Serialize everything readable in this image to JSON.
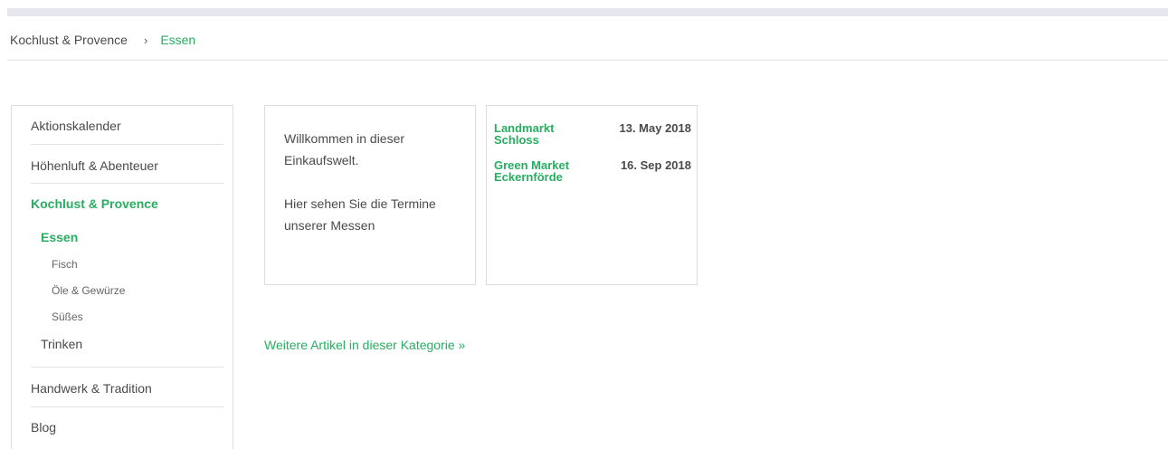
{
  "breadcrumb": {
    "items": [
      "Kochlust & Provence",
      "Essen"
    ],
    "separator": "›"
  },
  "sidebar": {
    "items": [
      {
        "label": "Aktionskalender"
      },
      {
        "label": "Höhenluft & Abenteuer"
      },
      {
        "label": "Kochlust & Provence",
        "active": true
      },
      {
        "label": "Handwerk & Tradition"
      },
      {
        "label": "Blog"
      }
    ],
    "sub": {
      "essen": "Essen",
      "fisch": "Fisch",
      "oele": "Öle & Gewürze",
      "suesses": "Süßes",
      "trinken": "Trinken"
    }
  },
  "welcome": {
    "line1": "Willkommen in dieser",
    "line2": "Einkaufswelt.",
    "line3": "Hier sehen Sie die Termine",
    "line4": "unserer Messen"
  },
  "events": [
    {
      "name_line1": "Landmarkt",
      "name_line2": "Schloss",
      "date": "13. May 2018"
    },
    {
      "name_line1": "Green Market",
      "name_line2": "Eckernförde",
      "date": "16. Sep 2018"
    }
  ],
  "more_link": "Weitere Artikel in dieser Kategorie »",
  "colors": {
    "accent": "#27ae60",
    "text": "#4a4a4a",
    "border": "#dcdcdc"
  }
}
